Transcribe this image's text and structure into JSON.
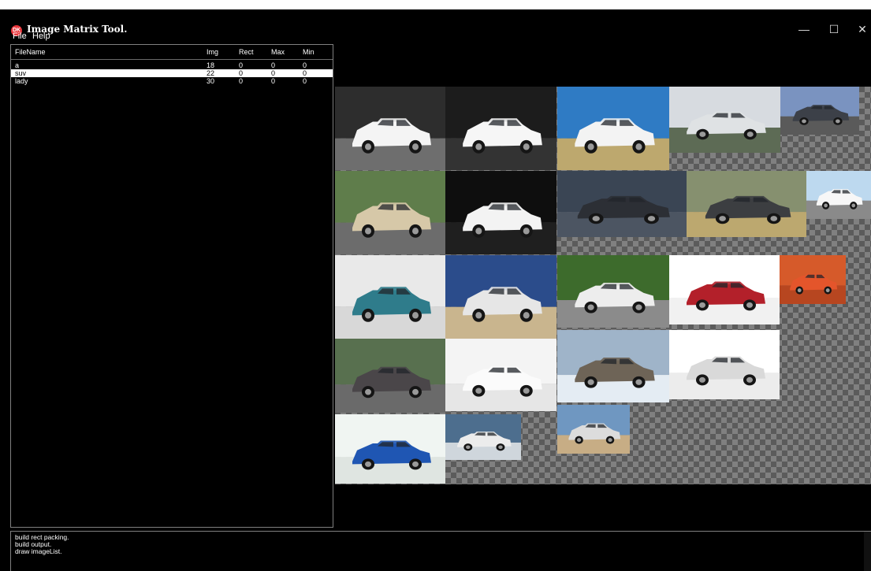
{
  "window": {
    "title": "Image Matrix Tool.",
    "icon_text": "DK",
    "controls": [
      "—",
      "☐",
      "✕"
    ]
  },
  "menu": [
    "File",
    "Help"
  ],
  "file_table": {
    "columns": [
      "FileName",
      "Img",
      "Rect",
      "Max",
      "Min"
    ],
    "rows": [
      {
        "name": "a",
        "img": "18",
        "rect": "0",
        "max": "0",
        "min": "0"
      },
      {
        "name": "suv",
        "img": "22",
        "rect": "0",
        "max": "0",
        "min": "0"
      },
      {
        "name": "lady",
        "img": "30",
        "rect": "0",
        "max": "0",
        "min": "0"
      }
    ],
    "selected_index": 1
  },
  "log": [
    "build rect packing.",
    "build output.",
    "draw imageList."
  ],
  "tiles": [
    {
      "sky": "#2d2d2d",
      "ground": "#6e6e6e",
      "car": "#f4f4f4"
    },
    {
      "sky": "#1c1c1c",
      "ground": "#333333",
      "car": "#f6f6f6"
    },
    {
      "sky": "#2f7bc4",
      "ground": "#bda86e",
      "car": "#f3f3f3"
    },
    {
      "sky": "#d7dbe0",
      "ground": "#5d6b55",
      "car": "#dfe2e4"
    },
    {
      "sky": "#7a93c0",
      "ground": "#5a5a5a",
      "car": "#3c4048"
    },
    {
      "sky": "#5f7d4b",
      "ground": "#6c6c6c",
      "car": "#d6c8a8"
    },
    {
      "sky": "#0e0e0e",
      "ground": "#1f1f1f",
      "car": "#f3f3f3"
    },
    {
      "sky": "#3a4554",
      "ground": "#4c5562",
      "car": "#2c2f35"
    },
    {
      "sky": "#86906f",
      "ground": "#bca86f",
      "car": "#3c3e41"
    },
    {
      "sky": "#bdd9ef",
      "ground": "#8a8a8a",
      "car": "#f7f7f7"
    },
    {
      "sky": "#e9e9e9",
      "ground": "#d8d8d8",
      "car": "#2f7c8b"
    },
    {
      "sky": "#2b4c8b",
      "ground": "#c9b58e",
      "car": "#e6e6e6"
    },
    {
      "sky": "#3d6b2c",
      "ground": "#8b8b8b",
      "car": "#ededed"
    },
    {
      "sky": "#ffffff",
      "ground": "#f1f1f1",
      "car": "#b3202a"
    },
    {
      "sky": "#d65a2a",
      "ground": "#b74620",
      "car": "#e4552b"
    },
    {
      "sky": "#58704f",
      "ground": "#6a6a6a",
      "car": "#4a4649"
    },
    {
      "sky": "#f4f4f4",
      "ground": "#e6e6e6",
      "car": "#fbfbfb"
    },
    {
      "sky": "#9fb4c9",
      "ground": "#e4ecf3",
      "car": "#6e6457"
    },
    {
      "sky": "#ffffff",
      "ground": "#ececec",
      "car": "#d9d9d9"
    },
    {
      "sky": "#f0f5f2",
      "ground": "#dfe5e1",
      "car": "#1f56b3"
    },
    {
      "sky": "#4d6e8e",
      "ground": "#cfd6dc",
      "car": "#ececec"
    },
    {
      "sky": "#6f97c1",
      "ground": "#c7ad85",
      "car": "#dcdcdc"
    }
  ]
}
